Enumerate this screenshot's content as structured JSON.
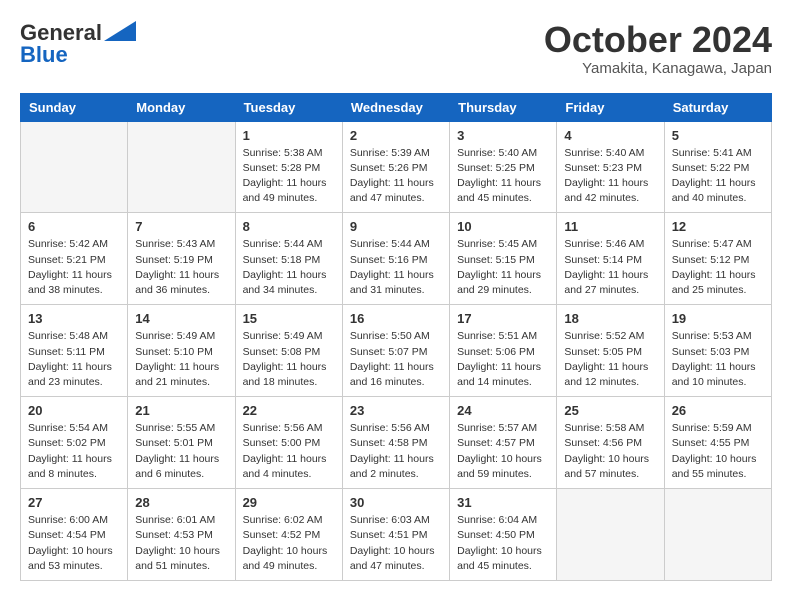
{
  "header": {
    "logo_general": "General",
    "logo_blue": "Blue",
    "month_title": "October 2024",
    "location": "Yamakita, Kanagawa, Japan"
  },
  "columns": [
    "Sunday",
    "Monday",
    "Tuesday",
    "Wednesday",
    "Thursday",
    "Friday",
    "Saturday"
  ],
  "weeks": [
    [
      {
        "day": "",
        "sunrise": "",
        "sunset": "",
        "daylight": ""
      },
      {
        "day": "",
        "sunrise": "",
        "sunset": "",
        "daylight": ""
      },
      {
        "day": "1",
        "sunrise": "Sunrise: 5:38 AM",
        "sunset": "Sunset: 5:28 PM",
        "daylight": "Daylight: 11 hours and 49 minutes."
      },
      {
        "day": "2",
        "sunrise": "Sunrise: 5:39 AM",
        "sunset": "Sunset: 5:26 PM",
        "daylight": "Daylight: 11 hours and 47 minutes."
      },
      {
        "day": "3",
        "sunrise": "Sunrise: 5:40 AM",
        "sunset": "Sunset: 5:25 PM",
        "daylight": "Daylight: 11 hours and 45 minutes."
      },
      {
        "day": "4",
        "sunrise": "Sunrise: 5:40 AM",
        "sunset": "Sunset: 5:23 PM",
        "daylight": "Daylight: 11 hours and 42 minutes."
      },
      {
        "day": "5",
        "sunrise": "Sunrise: 5:41 AM",
        "sunset": "Sunset: 5:22 PM",
        "daylight": "Daylight: 11 hours and 40 minutes."
      }
    ],
    [
      {
        "day": "6",
        "sunrise": "Sunrise: 5:42 AM",
        "sunset": "Sunset: 5:21 PM",
        "daylight": "Daylight: 11 hours and 38 minutes."
      },
      {
        "day": "7",
        "sunrise": "Sunrise: 5:43 AM",
        "sunset": "Sunset: 5:19 PM",
        "daylight": "Daylight: 11 hours and 36 minutes."
      },
      {
        "day": "8",
        "sunrise": "Sunrise: 5:44 AM",
        "sunset": "Sunset: 5:18 PM",
        "daylight": "Daylight: 11 hours and 34 minutes."
      },
      {
        "day": "9",
        "sunrise": "Sunrise: 5:44 AM",
        "sunset": "Sunset: 5:16 PM",
        "daylight": "Daylight: 11 hours and 31 minutes."
      },
      {
        "day": "10",
        "sunrise": "Sunrise: 5:45 AM",
        "sunset": "Sunset: 5:15 PM",
        "daylight": "Daylight: 11 hours and 29 minutes."
      },
      {
        "day": "11",
        "sunrise": "Sunrise: 5:46 AM",
        "sunset": "Sunset: 5:14 PM",
        "daylight": "Daylight: 11 hours and 27 minutes."
      },
      {
        "day": "12",
        "sunrise": "Sunrise: 5:47 AM",
        "sunset": "Sunset: 5:12 PM",
        "daylight": "Daylight: 11 hours and 25 minutes."
      }
    ],
    [
      {
        "day": "13",
        "sunrise": "Sunrise: 5:48 AM",
        "sunset": "Sunset: 5:11 PM",
        "daylight": "Daylight: 11 hours and 23 minutes."
      },
      {
        "day": "14",
        "sunrise": "Sunrise: 5:49 AM",
        "sunset": "Sunset: 5:10 PM",
        "daylight": "Daylight: 11 hours and 21 minutes."
      },
      {
        "day": "15",
        "sunrise": "Sunrise: 5:49 AM",
        "sunset": "Sunset: 5:08 PM",
        "daylight": "Daylight: 11 hours and 18 minutes."
      },
      {
        "day": "16",
        "sunrise": "Sunrise: 5:50 AM",
        "sunset": "Sunset: 5:07 PM",
        "daylight": "Daylight: 11 hours and 16 minutes."
      },
      {
        "day": "17",
        "sunrise": "Sunrise: 5:51 AM",
        "sunset": "Sunset: 5:06 PM",
        "daylight": "Daylight: 11 hours and 14 minutes."
      },
      {
        "day": "18",
        "sunrise": "Sunrise: 5:52 AM",
        "sunset": "Sunset: 5:05 PM",
        "daylight": "Daylight: 11 hours and 12 minutes."
      },
      {
        "day": "19",
        "sunrise": "Sunrise: 5:53 AM",
        "sunset": "Sunset: 5:03 PM",
        "daylight": "Daylight: 11 hours and 10 minutes."
      }
    ],
    [
      {
        "day": "20",
        "sunrise": "Sunrise: 5:54 AM",
        "sunset": "Sunset: 5:02 PM",
        "daylight": "Daylight: 11 hours and 8 minutes."
      },
      {
        "day": "21",
        "sunrise": "Sunrise: 5:55 AM",
        "sunset": "Sunset: 5:01 PM",
        "daylight": "Daylight: 11 hours and 6 minutes."
      },
      {
        "day": "22",
        "sunrise": "Sunrise: 5:56 AM",
        "sunset": "Sunset: 5:00 PM",
        "daylight": "Daylight: 11 hours and 4 minutes."
      },
      {
        "day": "23",
        "sunrise": "Sunrise: 5:56 AM",
        "sunset": "Sunset: 4:58 PM",
        "daylight": "Daylight: 11 hours and 2 minutes."
      },
      {
        "day": "24",
        "sunrise": "Sunrise: 5:57 AM",
        "sunset": "Sunset: 4:57 PM",
        "daylight": "Daylight: 10 hours and 59 minutes."
      },
      {
        "day": "25",
        "sunrise": "Sunrise: 5:58 AM",
        "sunset": "Sunset: 4:56 PM",
        "daylight": "Daylight: 10 hours and 57 minutes."
      },
      {
        "day": "26",
        "sunrise": "Sunrise: 5:59 AM",
        "sunset": "Sunset: 4:55 PM",
        "daylight": "Daylight: 10 hours and 55 minutes."
      }
    ],
    [
      {
        "day": "27",
        "sunrise": "Sunrise: 6:00 AM",
        "sunset": "Sunset: 4:54 PM",
        "daylight": "Daylight: 10 hours and 53 minutes."
      },
      {
        "day": "28",
        "sunrise": "Sunrise: 6:01 AM",
        "sunset": "Sunset: 4:53 PM",
        "daylight": "Daylight: 10 hours and 51 minutes."
      },
      {
        "day": "29",
        "sunrise": "Sunrise: 6:02 AM",
        "sunset": "Sunset: 4:52 PM",
        "daylight": "Daylight: 10 hours and 49 minutes."
      },
      {
        "day": "30",
        "sunrise": "Sunrise: 6:03 AM",
        "sunset": "Sunset: 4:51 PM",
        "daylight": "Daylight: 10 hours and 47 minutes."
      },
      {
        "day": "31",
        "sunrise": "Sunrise: 6:04 AM",
        "sunset": "Sunset: 4:50 PM",
        "daylight": "Daylight: 10 hours and 45 minutes."
      },
      {
        "day": "",
        "sunrise": "",
        "sunset": "",
        "daylight": ""
      },
      {
        "day": "",
        "sunrise": "",
        "sunset": "",
        "daylight": ""
      }
    ]
  ]
}
